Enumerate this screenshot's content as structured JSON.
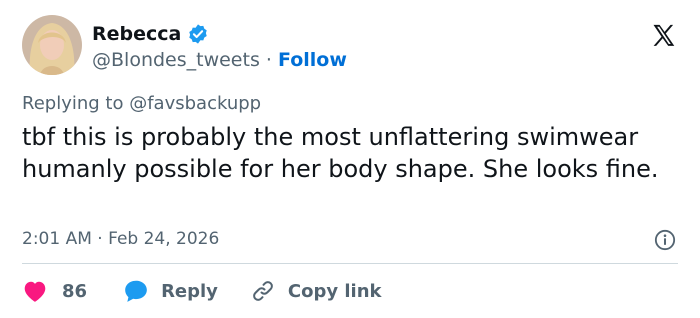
{
  "author": {
    "name": "Rebecca",
    "handle": "@Blondes_tweets",
    "separator": "·",
    "follow_label": "Follow"
  },
  "reply_context": {
    "prefix": "Replying to",
    "target": "@favsbackupp"
  },
  "tweet": {
    "text": "tbf this is probably the most unflattering swimwear humanly possible for her body shape. She looks fine.",
    "time": "2:01 AM",
    "date": "Feb 24, 2026"
  },
  "actions": {
    "like_count": "86",
    "reply_label": "Reply",
    "copy_label": "Copy link"
  },
  "colors": {
    "accent": "#1d9bf0",
    "follow": "#006fd6",
    "like": "#f91880",
    "muted": "#536471"
  },
  "icons": [
    "verified-badge-icon",
    "x-logo-icon",
    "info-icon",
    "heart-icon",
    "reply-bubble-icon",
    "link-icon"
  ]
}
